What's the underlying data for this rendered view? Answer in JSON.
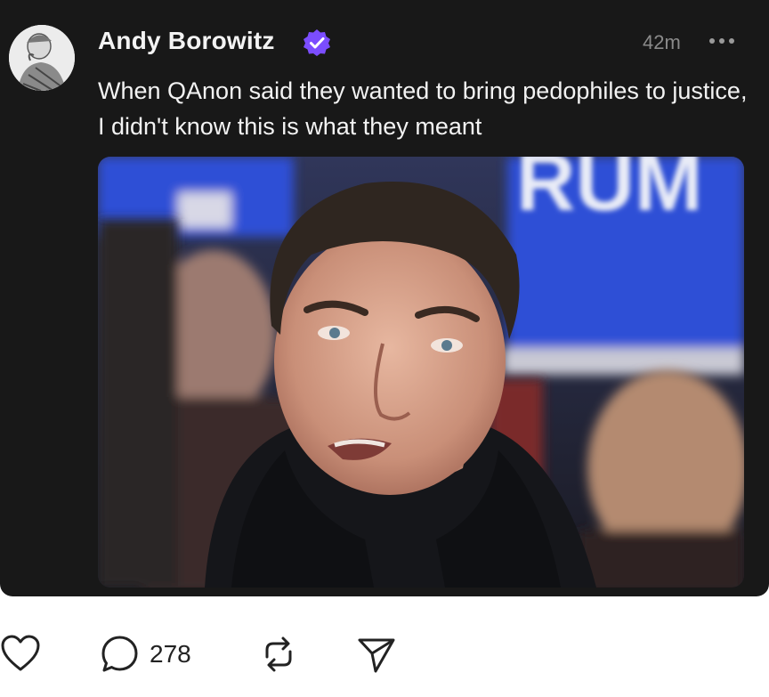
{
  "post": {
    "author": "Andy Borowitz",
    "verified": true,
    "timestamp": "42m",
    "text": "When QAnon said they wanted to bring pedophiles to justice, I didn't know this is what they meant",
    "image_sign_text": "RUM"
  },
  "actions": {
    "like_icon": "heart-icon",
    "comment_icon": "comment-icon",
    "comment_count": "278",
    "repost_icon": "repost-icon",
    "share_icon": "send-icon"
  },
  "colors": {
    "card_background": "#181818",
    "verified_badge": "#7b4dff",
    "timestamp": "#8a8a8a",
    "sign_blue": "#2d4fd6"
  }
}
